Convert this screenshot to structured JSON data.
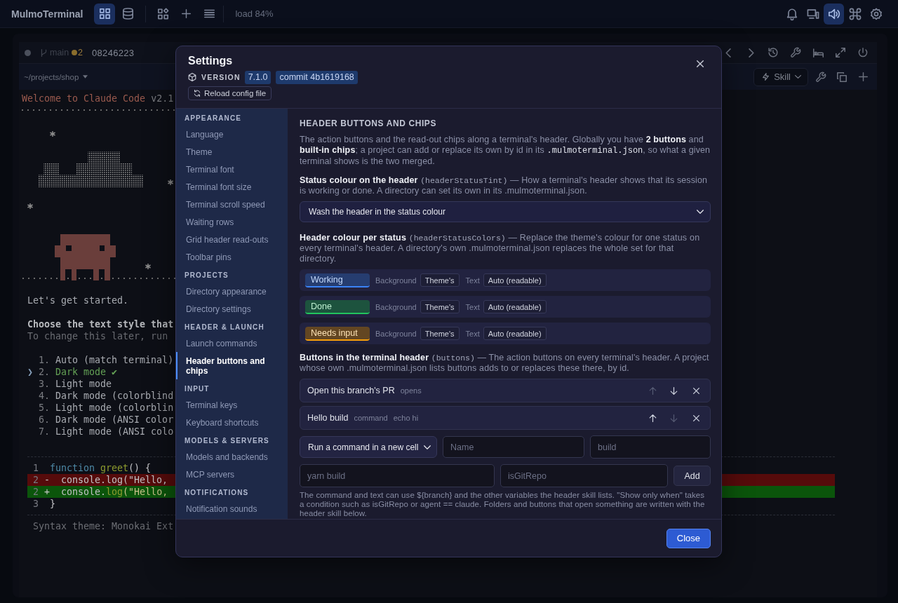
{
  "top_bar": {
    "title": "MulmoTerminal",
    "view_buttons": [
      {
        "kind": "grid",
        "selected": true
      },
      {
        "kind": "database",
        "selected": false
      }
    ],
    "load": "load 84%",
    "right_buttons": [
      {
        "kind": "bell",
        "selected": false
      },
      {
        "kind": "devices",
        "selected": false
      },
      {
        "kind": "speaker",
        "selected": true
      },
      {
        "kind": "command",
        "selected": false
      },
      {
        "kind": "gear",
        "selected": false
      }
    ]
  },
  "terminal": {
    "branch": "main",
    "changes": "2",
    "session": "08246223",
    "path": "~/projects/shop",
    "skill_button": "Skill",
    "welcome": "Welcome to Claude Code",
    "version": "v2.1",
    "intro": "Let's get started.",
    "prompt": "Choose the text style that",
    "hint": "To change this later, run",
    "cursor": "❯",
    "options": [
      {
        "number": "1.",
        "label": "Auto (match terminal)",
        "selected": false
      },
      {
        "number": "2.",
        "label": "Dark mode ✔",
        "selected": true
      },
      {
        "number": "3.",
        "label": "Light mode",
        "selected": false
      },
      {
        "number": "4.",
        "label": "Dark mode (colorblind",
        "selected": false
      },
      {
        "number": "5.",
        "label": "Light mode (colorblin",
        "selected": false
      },
      {
        "number": "6.",
        "label": "Dark mode (ANSI color",
        "selected": false
      },
      {
        "number": "7.",
        "label": "Light mode (ANSI colo",
        "selected": false
      }
    ],
    "diff": [
      {
        "kind": "context",
        "number": "1",
        "tokens": [
          {
            "kind": "keyword",
            "text": "function "
          },
          {
            "kind": "name",
            "text": "greet"
          },
          {
            "kind": "plain",
            "text": "() {"
          }
        ]
      },
      {
        "kind": "removed",
        "number": "2",
        "sign": "-",
        "tokens": [
          {
            "kind": "plain",
            "text": "  console.log(\"Hello,"
          }
        ]
      },
      {
        "kind": "added",
        "number": "2",
        "sign": "+",
        "tokens": [
          {
            "kind": "plain",
            "text": "  console."
          },
          {
            "kind": "name",
            "text": "log"
          },
          {
            "kind": "string",
            "text": "(\"Hello,"
          }
        ]
      },
      {
        "kind": "context",
        "number": "3",
        "tokens": [
          {
            "kind": "plain",
            "text": "}"
          }
        ]
      }
    ],
    "syntax_theme": "Syntax theme: Monokai Ext"
  },
  "settings": {
    "title": "Settings",
    "version_label": "VERSION",
    "version": "7.1.0",
    "commit": "commit 4b1619168",
    "reload_button": "Reload config file",
    "nav": [
      {
        "heading": "APPEARANCE",
        "items": [
          {
            "label": "Language",
            "selected": false
          },
          {
            "label": "Theme",
            "selected": false
          },
          {
            "label": "Terminal font",
            "selected": false
          },
          {
            "label": "Terminal font size",
            "selected": false
          },
          {
            "label": "Terminal scroll speed",
            "selected": false
          },
          {
            "label": "Waiting rows",
            "selected": false
          },
          {
            "label": "Grid header read-outs",
            "selected": false
          },
          {
            "label": "Toolbar pins",
            "selected": false
          }
        ]
      },
      {
        "heading": "PROJECTS",
        "items": [
          {
            "label": "Directory appearance",
            "selected": false
          },
          {
            "label": "Directory settings",
            "selected": false
          }
        ]
      },
      {
        "heading": "HEADER & LAUNCH",
        "items": [
          {
            "label": "Launch commands",
            "selected": false
          },
          {
            "label": "Header buttons and chips",
            "selected": true
          }
        ]
      },
      {
        "heading": "INPUT",
        "items": [
          {
            "label": "Terminal keys",
            "selected": false
          },
          {
            "label": "Keyboard shortcuts",
            "selected": false
          }
        ]
      },
      {
        "heading": "MODELS & SERVERS",
        "items": [
          {
            "label": "Models and backends",
            "selected": false
          },
          {
            "label": "MCP servers",
            "selected": false
          }
        ]
      },
      {
        "heading": "NOTIFICATIONS",
        "items": [
          {
            "label": "Notification sounds",
            "selected": false
          }
        ]
      }
    ],
    "page": {
      "heading": "HEADER BUTTONS AND CHIPS",
      "intro": [
        {
          "kind": "text",
          "text": "The action buttons and the read-out chips along a terminal's header. Globally you have "
        },
        {
          "kind": "bold",
          "text": "2 buttons"
        },
        {
          "kind": "text",
          "text": " and "
        },
        {
          "kind": "bold",
          "text": "built-in chips"
        },
        {
          "kind": "text",
          "text": "; a project can add or replace its own by id in its "
        },
        {
          "kind": "code",
          "text": ".mulmoterminal.json"
        },
        {
          "kind": "text",
          "text": ", so what a given terminal shows is the two merged."
        }
      ],
      "status_tint": {
        "description": [
          {
            "kind": "bold",
            "text": "Status colour on the header "
          },
          {
            "kind": "code",
            "text": "(headerStatusTint)"
          },
          {
            "kind": "text",
            "text": " — How a terminal's header shows that its session is working or done. A directory can set its own in its .mulmoterminal.json."
          }
        ],
        "value": "Wash the header in the status colour"
      },
      "status_colors": {
        "description": [
          {
            "kind": "bold",
            "text": "Header colour per status "
          },
          {
            "kind": "code",
            "text": "(headerStatusColors)"
          },
          {
            "kind": "text",
            "text": " — Replace the theme's colour for one status on every terminal's header. A directory's own .mulmoterminal.json replaces the whole set for that directory."
          }
        ],
        "rows": [
          {
            "status": "Working",
            "color": "#3b82f6",
            "background_label": "Background",
            "background": "Theme's",
            "text_label": "Text",
            "text": "Auto (readable)"
          },
          {
            "status": "Done",
            "color": "#22c55e",
            "background_label": "Background",
            "background": "Theme's",
            "text_label": "Text",
            "text": "Auto (readable)"
          },
          {
            "status": "Needs input",
            "color": "#f59e0b",
            "background_label": "Background",
            "background": "Theme's",
            "text_label": "Text",
            "text": "Auto (readable)"
          }
        ]
      },
      "buttons": {
        "description": [
          {
            "kind": "bold",
            "text": "Buttons in the terminal header "
          },
          {
            "kind": "code",
            "text": "(buttons)"
          },
          {
            "kind": "text",
            "text": " — The action buttons on every terminal's header. A project whose own .mulmoterminal.json lists buttons adds to or replaces these there, by id."
          }
        ],
        "items": [
          {
            "label": "Open this branch's PR",
            "details": [
              "opens"
            ],
            "moves": [
              {
                "kind": "up",
                "disabled": true
              },
              {
                "kind": "down",
                "disabled": false
              }
            ]
          },
          {
            "label": "Hello build",
            "details": [
              "command",
              "echo hi"
            ],
            "moves": [
              {
                "kind": "up",
                "disabled": false
              },
              {
                "kind": "down",
                "disabled": true
              }
            ]
          }
        ],
        "new_button": {
          "type": "Run a command in a new cell",
          "fields": [
            {
              "placeholder": "Name"
            },
            {
              "placeholder": "build"
            },
            {
              "placeholder": "yarn build"
            },
            {
              "placeholder": "isGitRepo"
            }
          ],
          "add_button": "Add"
        }
      },
      "help": "The command and text can use ${branch} and the other variables the header skill lists. \"Show only when\" takes a condition such as isGitRepo or agent == claude. Folders and buttons that open something are written with the header skill below."
    },
    "close_button": "Close"
  }
}
